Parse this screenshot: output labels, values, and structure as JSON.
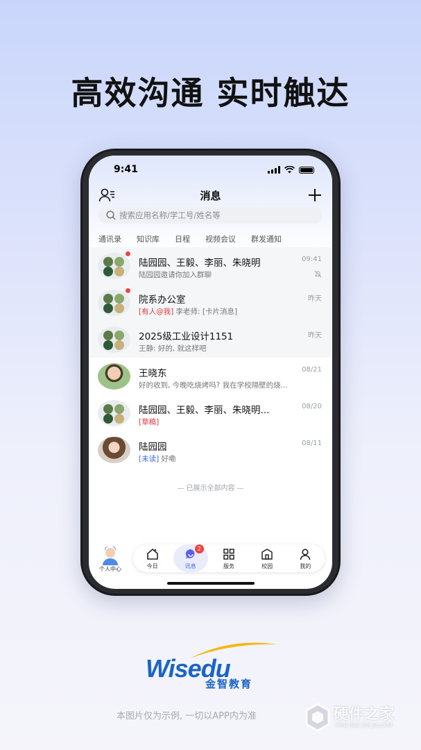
{
  "headline": "高效沟通 实时触达",
  "status_bar": {
    "time": "9:41"
  },
  "header": {
    "title": "消息"
  },
  "search": {
    "placeholder": "搜索应用名称/学工号/姓名等"
  },
  "tabs": [
    "通讯录",
    "知识库",
    "日程",
    "视频会议",
    "群发通知"
  ],
  "conversations": [
    {
      "name": "陆园园、王毅、李丽、朱晓明",
      "time": "09:41",
      "tag": "",
      "preview": "陆园园邀请你加入群聊",
      "unread_dot": true,
      "muted": true
    },
    {
      "name": "院系办公室",
      "time": "昨天",
      "tag": "[有人@我]",
      "preview": " 李老师: [卡片消息]",
      "unread_dot": true,
      "muted": false
    },
    {
      "name": "2025级工业设计1151",
      "time": "昨天",
      "tag": "",
      "preview": "王静: 好的, 就这样吧",
      "unread_dot": false,
      "muted": false
    },
    {
      "name": "王晓东",
      "time": "08/21",
      "tag": "",
      "preview": "好的收到, 今晚吃烧烤吗? 我在学校隔壁的烧...",
      "unread_dot": false,
      "muted": false
    },
    {
      "name": "陆园园、王毅、李丽、朱晓明...",
      "time": "08/20",
      "tag": "[草稿]",
      "preview": "",
      "unread_dot": false,
      "muted": false
    },
    {
      "name": "陆园园",
      "time": "08/11",
      "tag": "[未读]",
      "preview": " 好嘞",
      "unread_dot": false,
      "muted": false
    }
  ],
  "end_text": "— 已展示全部内容 —",
  "bottom_nav": {
    "me_label": "个人中心",
    "items": [
      {
        "label": "今日",
        "icon": "home-icon"
      },
      {
        "label": "讯息",
        "icon": "chat-icon",
        "badge": "2",
        "active": true
      },
      {
        "label": "服务",
        "icon": "grid-icon"
      },
      {
        "label": "校园",
        "icon": "campus-icon"
      },
      {
        "label": "我的",
        "icon": "person-icon"
      }
    ]
  },
  "logo": {
    "word": "Wisedu",
    "cn": "金智教育"
  },
  "disclaimer": "本图片仅为示例, 一切以APP内为准",
  "watermark": {
    "cn": "硬件之家",
    "en": "YING JIAN ZHI JIA.COM"
  },
  "colors": {
    "accent": "#4c5ef0",
    "unread_red": "#f1433f",
    "mention_red": "#e0393e",
    "unread_blue": "#3a6cf0",
    "brand_blue": "#1a64c8"
  }
}
